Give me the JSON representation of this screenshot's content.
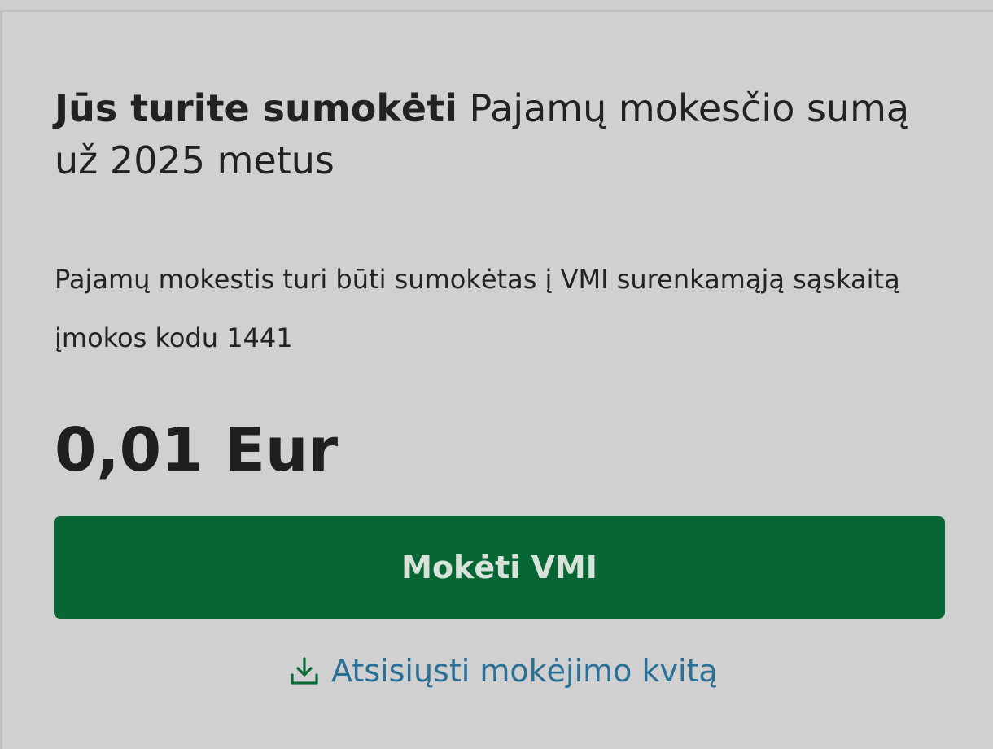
{
  "header": {
    "title_bold": "Jūs turite sumokėti",
    "title_rest": " Pajamų mokesčio sumą už 2025 metus"
  },
  "payment": {
    "description": "Pajamų mokestis turi būti sumokėtas į VMI surenkamąją sąskaitą įmokos kodu 1441",
    "amount": "0,01 Eur",
    "pay_button_label": "Mokėti VMI",
    "download_link_label": "Atsisiųsti mokėjimo kvitą",
    "download_icon": "download-icon"
  },
  "colors": {
    "background": "#cfcfcf",
    "button": "#076633",
    "button_text": "#d9e2da",
    "link": "#2a6f96",
    "icon": "#0d6b3a",
    "text": "#222222"
  }
}
